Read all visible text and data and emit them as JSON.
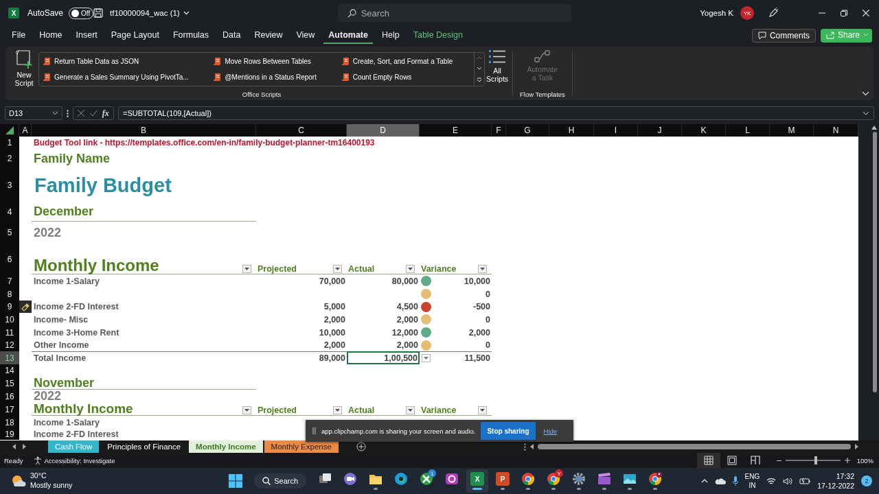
{
  "title_bar": {
    "logo_letter": "X",
    "autosave": {
      "label": "AutoSave",
      "on": false,
      "state": "Off"
    },
    "file_name": "tf10000094_wac (1)",
    "search_placeholder": "Search",
    "user_name": "Yogesh K",
    "user_initials": "YK"
  },
  "menu_tabs": [
    {
      "label": "File",
      "kind": "normal",
      "selected": false
    },
    {
      "label": "Home",
      "kind": "normal",
      "selected": false
    },
    {
      "label": "Insert",
      "kind": "normal",
      "selected": false
    },
    {
      "label": "Page Layout",
      "kind": "normal",
      "selected": false
    },
    {
      "label": "Formulas",
      "kind": "normal",
      "selected": false
    },
    {
      "label": "Data",
      "kind": "normal",
      "selected": false
    },
    {
      "label": "Review",
      "kind": "normal",
      "selected": false
    },
    {
      "label": "View",
      "kind": "normal",
      "selected": false
    },
    {
      "label": "Automate",
      "kind": "normal",
      "selected": true
    },
    {
      "label": "Help",
      "kind": "normal",
      "selected": false
    },
    {
      "label": "Table Design",
      "kind": "contextual",
      "selected": false
    }
  ],
  "comments_button": "Comments",
  "share_button": "Share",
  "ribbon": {
    "new_script": "New Script",
    "scripts": [
      "Return Table Data as JSON",
      "Move Rows Between Tables",
      "Create, Sort, and Format a Table",
      "Generate a Sales Summary Using PivotTa...",
      "@Mentions in a Status Report",
      "Count Empty Rows"
    ],
    "scripts_group": "Office Scripts",
    "all_scripts": "All Scripts",
    "automate_task": {
      "label": "Automate a Task",
      "disabled": true
    },
    "flow_group": "Flow Templates"
  },
  "formula_bar": {
    "name_box": "D13",
    "function_label": "fx",
    "formula": "=SUBTOTAL(109,[Actual])"
  },
  "columns": [
    {
      "label": "A",
      "selected": false
    },
    {
      "label": "B",
      "selected": false
    },
    {
      "label": "C",
      "selected": false
    },
    {
      "label": "D",
      "selected": true
    },
    {
      "label": "E",
      "selected": false
    },
    {
      "label": "F",
      "selected": false
    },
    {
      "label": "G",
      "selected": false
    },
    {
      "label": "H",
      "selected": false
    },
    {
      "label": "I",
      "selected": false
    },
    {
      "label": "J",
      "selected": false
    },
    {
      "label": "K",
      "selected": false
    },
    {
      "label": "L",
      "selected": false
    },
    {
      "label": "M",
      "selected": false
    },
    {
      "label": "N",
      "selected": false
    }
  ],
  "rows": [
    {
      "label": "1",
      "selected": false
    },
    {
      "label": "2",
      "selected": false
    },
    {
      "label": "3",
      "selected": false
    },
    {
      "label": "4",
      "selected": false
    },
    {
      "label": "5",
      "selected": false
    },
    {
      "label": "6",
      "selected": false
    },
    {
      "label": "7",
      "selected": false
    },
    {
      "label": "8",
      "selected": false
    },
    {
      "label": "9",
      "selected": false
    },
    {
      "label": "10",
      "selected": false
    },
    {
      "label": "11",
      "selected": false
    },
    {
      "label": "12",
      "selected": false
    },
    {
      "label": "13",
      "selected": true
    },
    {
      "label": "14",
      "selected": false
    },
    {
      "label": "15",
      "selected": false
    },
    {
      "label": "16",
      "selected": false
    },
    {
      "label": "17",
      "selected": false
    },
    {
      "label": "18",
      "selected": false
    },
    {
      "label": "19",
      "selected": false
    }
  ],
  "sheet": {
    "link_label": "Budget Tool link - ",
    "link_url": "https://templates.office.com/en-in/family-budget-planner-tm16400193",
    "family_name": "Family Name",
    "title": "Family Budget",
    "month": "December",
    "year": "2022",
    "income": {
      "title": "Monthly Income",
      "headers": [
        "Projected",
        "Actual",
        "Variance"
      ],
      "rows": [
        {
          "label": "Income 1-Salary",
          "projected": "70,000",
          "actual": "80,000",
          "color": "#5fab87",
          "variance": "10,000"
        },
        {
          "color": "#e6bd72",
          "variance": "0"
        },
        {
          "label": "Income 2-FD Interest",
          "projected": "5,000",
          "actual": "4,500",
          "color": "#c8452e",
          "variance": "-500"
        },
        {
          "label": "Income- Misc",
          "projected": "2,000",
          "actual": "2,000",
          "color": "#e6bd72",
          "variance": "0"
        },
        {
          "label": "Income 3-Home Rent",
          "projected": "10,000",
          "actual": "12,000",
          "color": "#5fab87",
          "variance": "2,000"
        },
        {
          "label": "Other Income",
          "projected": "2,000",
          "actual": "2,000",
          "color": "#e6bd72",
          "variance": "0"
        }
      ],
      "total": {
        "label": "Total Income",
        "projected": "89,000",
        "actual": "1,00,500",
        "variance": "11,500",
        "selected": true
      }
    },
    "previous": {
      "month": "November",
      "year": "2022",
      "title": "Monthly Income",
      "headers": [
        "Projected",
        "Actual",
        "Variance"
      ],
      "rows": [
        "Income 1-Salary",
        "Income 2-FD Interest"
      ]
    }
  },
  "sheet_tabs": [
    {
      "label": "Cash Flow",
      "color": "#35b5c9",
      "selected": false
    },
    {
      "label": "Principles of Finance",
      "selected": false
    },
    {
      "label": "Monthly Income",
      "color": "#e2efda",
      "selected": true
    },
    {
      "label": "Monthly Expense",
      "color": "#ec8a45",
      "selected": false
    }
  ],
  "status_bar": {
    "ready": "Ready",
    "accessibility": "Accessibility: Investigate",
    "views": [
      {
        "kind": "normal",
        "selected": true
      },
      {
        "kind": "page_layout",
        "selected": false
      },
      {
        "kind": "page_break",
        "selected": false
      }
    ],
    "zoom_slider": {
      "level": 0.55
    },
    "zoom": "100%"
  },
  "toast": {
    "text": "app.clipchamp.com is sharing your screen and audio.",
    "stop_button": "Stop sharing",
    "hide_link": "Hide"
  },
  "taskbar": {
    "weather": {
      "temp": "30°C",
      "condition": "Mostly sunny"
    },
    "search": "Search",
    "apps": [
      {
        "kind": "task_view",
        "running": false,
        "selected": false
      },
      {
        "kind": "meet",
        "running": false,
        "selected": false
      },
      {
        "kind": "folder",
        "running": true,
        "selected": false
      },
      {
        "kind": "edge",
        "running": false,
        "selected": false
      },
      {
        "kind": "xbox",
        "badge": "1",
        "running": false,
        "selected": false
      },
      {
        "kind": "clipchamp",
        "running": false,
        "selected": false
      },
      {
        "kind": "office",
        "letter": "X",
        "color": "#1d8f4e",
        "running": true,
        "selected": true
      },
      {
        "kind": "office",
        "letter": "P",
        "color": "#d04a24",
        "running": true,
        "selected": false
      },
      {
        "kind": "chrome",
        "running": true,
        "selected": false
      },
      {
        "kind": "chrome",
        "badge": "Y",
        "running": true,
        "selected": false
      },
      {
        "kind": "settings",
        "running": true,
        "selected": false
      },
      {
        "kind": "clapper",
        "running": true,
        "selected": false
      },
      {
        "kind": "photos",
        "running": true,
        "selected": false
      },
      {
        "kind": "chrome_profile",
        "running": true,
        "selected": false
      }
    ],
    "language": "ENG",
    "region": "IN",
    "time": "17:32",
    "date": "17-12-2022",
    "notifications": "2"
  }
}
